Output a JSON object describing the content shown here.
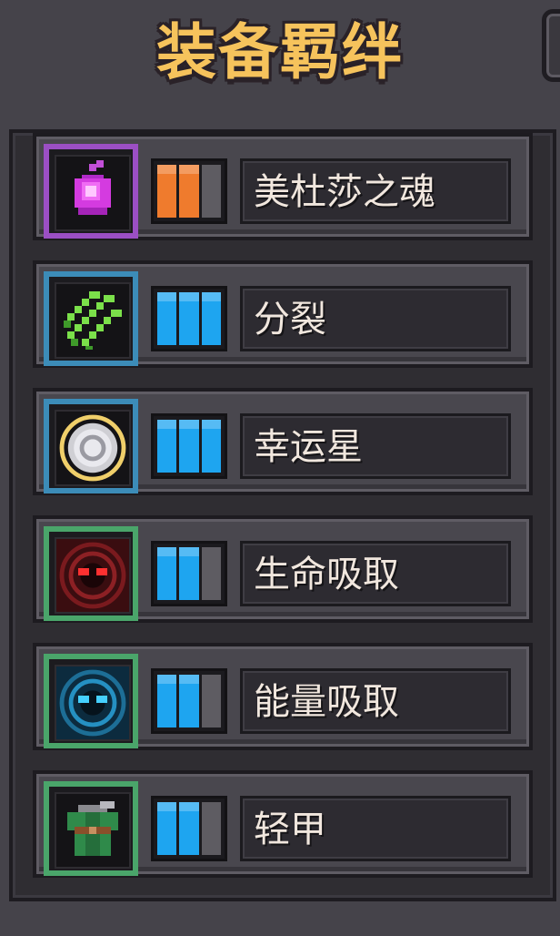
{
  "title": "装备羁绊",
  "bonds": [
    {
      "name": "美杜莎之魂",
      "level": 2,
      "max_level": 3,
      "rarity_color": "#9b4fc4",
      "bar_color": "#ef7b2d",
      "icon": "medusa-soul-icon"
    },
    {
      "name": "分裂",
      "level": 3,
      "max_level": 3,
      "rarity_color": "#3c8cb8",
      "bar_color": "#1ea5f0",
      "icon": "split-arrows-icon"
    },
    {
      "name": "幸运星",
      "level": 3,
      "max_level": 3,
      "rarity_color": "#3c8cb8",
      "bar_color": "#1ea5f0",
      "icon": "lucky-coin-icon"
    },
    {
      "name": "生命吸取",
      "level": 2,
      "max_level": 3,
      "rarity_color": "#4aa56a",
      "bar_color": "#1ea5f0",
      "icon": "life-drain-icon"
    },
    {
      "name": "能量吸取",
      "level": 2,
      "max_level": 3,
      "rarity_color": "#4aa56a",
      "bar_color": "#1ea5f0",
      "icon": "energy-drain-icon"
    },
    {
      "name": "轻甲",
      "level": 2,
      "max_level": 3,
      "rarity_color": "#4aa56a",
      "bar_color": "#1ea5f0",
      "icon": "light-armor-icon"
    }
  ]
}
